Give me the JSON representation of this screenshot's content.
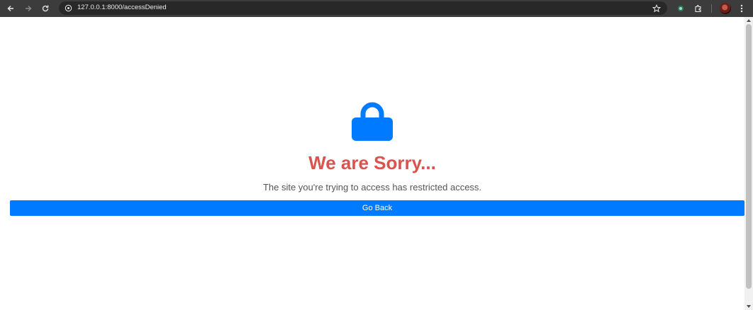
{
  "browser": {
    "url": "127.0.0.1:8000/accessDenied",
    "icons": {
      "back": "back-arrow-icon",
      "forward": "forward-arrow-icon",
      "reload": "reload-icon",
      "site_info": "site-info-icon",
      "bookmark": "star-icon",
      "extension": "extension-icon",
      "extensions_menu": "puzzle-icon",
      "menu": "kebab-menu-icon"
    }
  },
  "page": {
    "lock_icon": "lock-icon",
    "title": "We are Sorry...",
    "message": "The site you're trying to access has restricted access.",
    "go_back_label": "Go Back"
  },
  "colors": {
    "accent": "#007bff",
    "title": "#d9534f",
    "text": "#555555"
  }
}
